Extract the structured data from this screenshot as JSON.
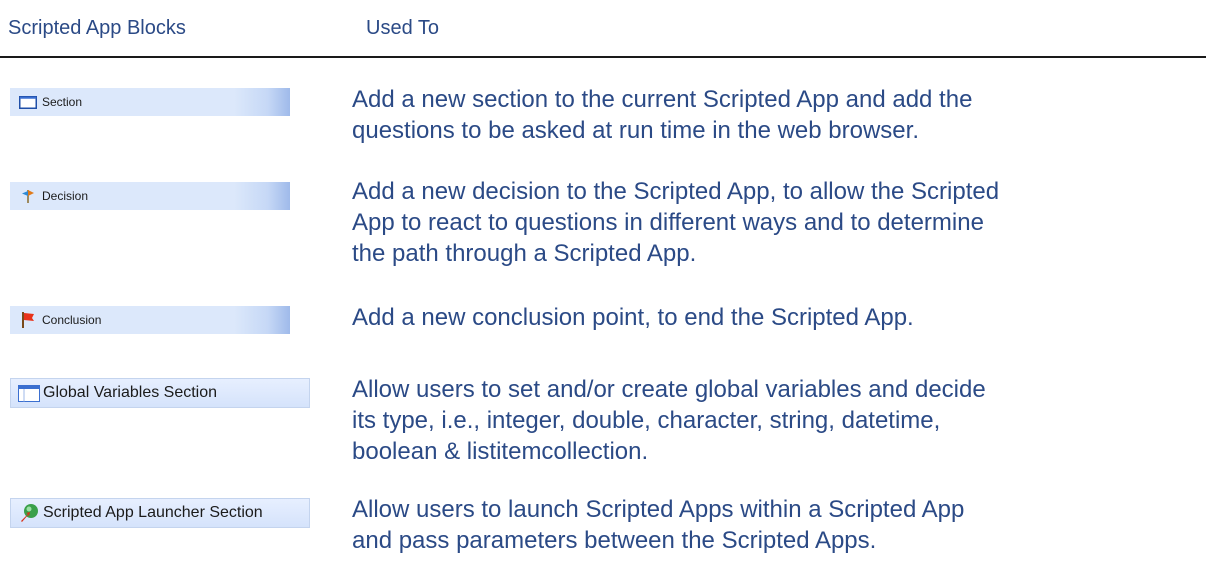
{
  "header": {
    "col_blocks": "Scripted App Blocks",
    "col_used_to": "Used To"
  },
  "rows": [
    {
      "label": "Section",
      "icon": "section-icon",
      "description": "Add a new section to the current Scripted App and add the\nquestions to be asked at run time in the web browser."
    },
    {
      "label": "Decision",
      "icon": "decision-icon",
      "description": "Add a new decision to the Scripted App, to allow the Scripted\nApp to react to questions in different ways and to determine\nthe path through a Scripted App."
    },
    {
      "label": "Conclusion",
      "icon": "flag-icon",
      "description": "Add a new conclusion point, to end the Scripted App."
    },
    {
      "label": "Global Variables Section",
      "icon": "window-icon",
      "description": "Allow users to set and/or create global variables and decide\nits type, i.e., integer, double, character, string, datetime,\nboolean & listitemcollection."
    },
    {
      "label": "Scripted App Launcher Section",
      "icon": "launcher-icon",
      "description": "Allow users to launch Scripted Apps within a Scripted App\nand pass parameters between the Scripted Apps."
    }
  ]
}
